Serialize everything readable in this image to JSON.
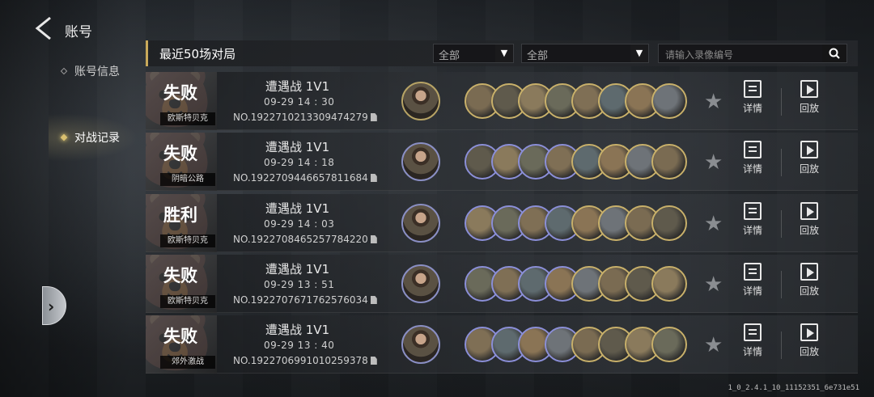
{
  "header": {
    "title": "账号"
  },
  "sidebar": {
    "items": [
      {
        "label": "账号信息",
        "active": false
      },
      {
        "label": "对战记录",
        "active": true
      }
    ]
  },
  "list": {
    "title": "最近50场对局",
    "filter1": "全部",
    "filter2": "全部",
    "search_placeholder": "请输入录像编号"
  },
  "matches": [
    {
      "result": "失败",
      "map": "欧斯特贝克",
      "mode": "遭遇战 1V1",
      "time": "09-29  14 : 30",
      "number": "NO.1922710213309474279"
    },
    {
      "result": "失败",
      "map": "阴暗公路",
      "mode": "遭遇战 1V1",
      "time": "09-29  14 : 18",
      "number": "NO.1922709446657811684"
    },
    {
      "result": "胜利",
      "map": "欧斯特贝克",
      "mode": "遭遇战 1V1",
      "time": "09-29  14 : 03",
      "number": "NO.1922708465257784220"
    },
    {
      "result": "失败",
      "map": "欧斯特贝克",
      "mode": "遭遇战 1V1",
      "time": "09-29  13 : 51",
      "number": "NO.1922707671762576034"
    },
    {
      "result": "失败",
      "map": "郊外激战",
      "mode": "遭遇战 1V1",
      "time": "09-29  13 : 40",
      "number": "NO.1922706991010259378"
    }
  ],
  "actions": {
    "details": "详情",
    "replay": "回放"
  },
  "version": "1_0_2.4.1_10_11152351_6e731e51",
  "colors": {
    "accent_gold": "#c9a95a",
    "unit_gold_border": "#c8b06a",
    "unit_blue_border": "#8b8fd8"
  }
}
